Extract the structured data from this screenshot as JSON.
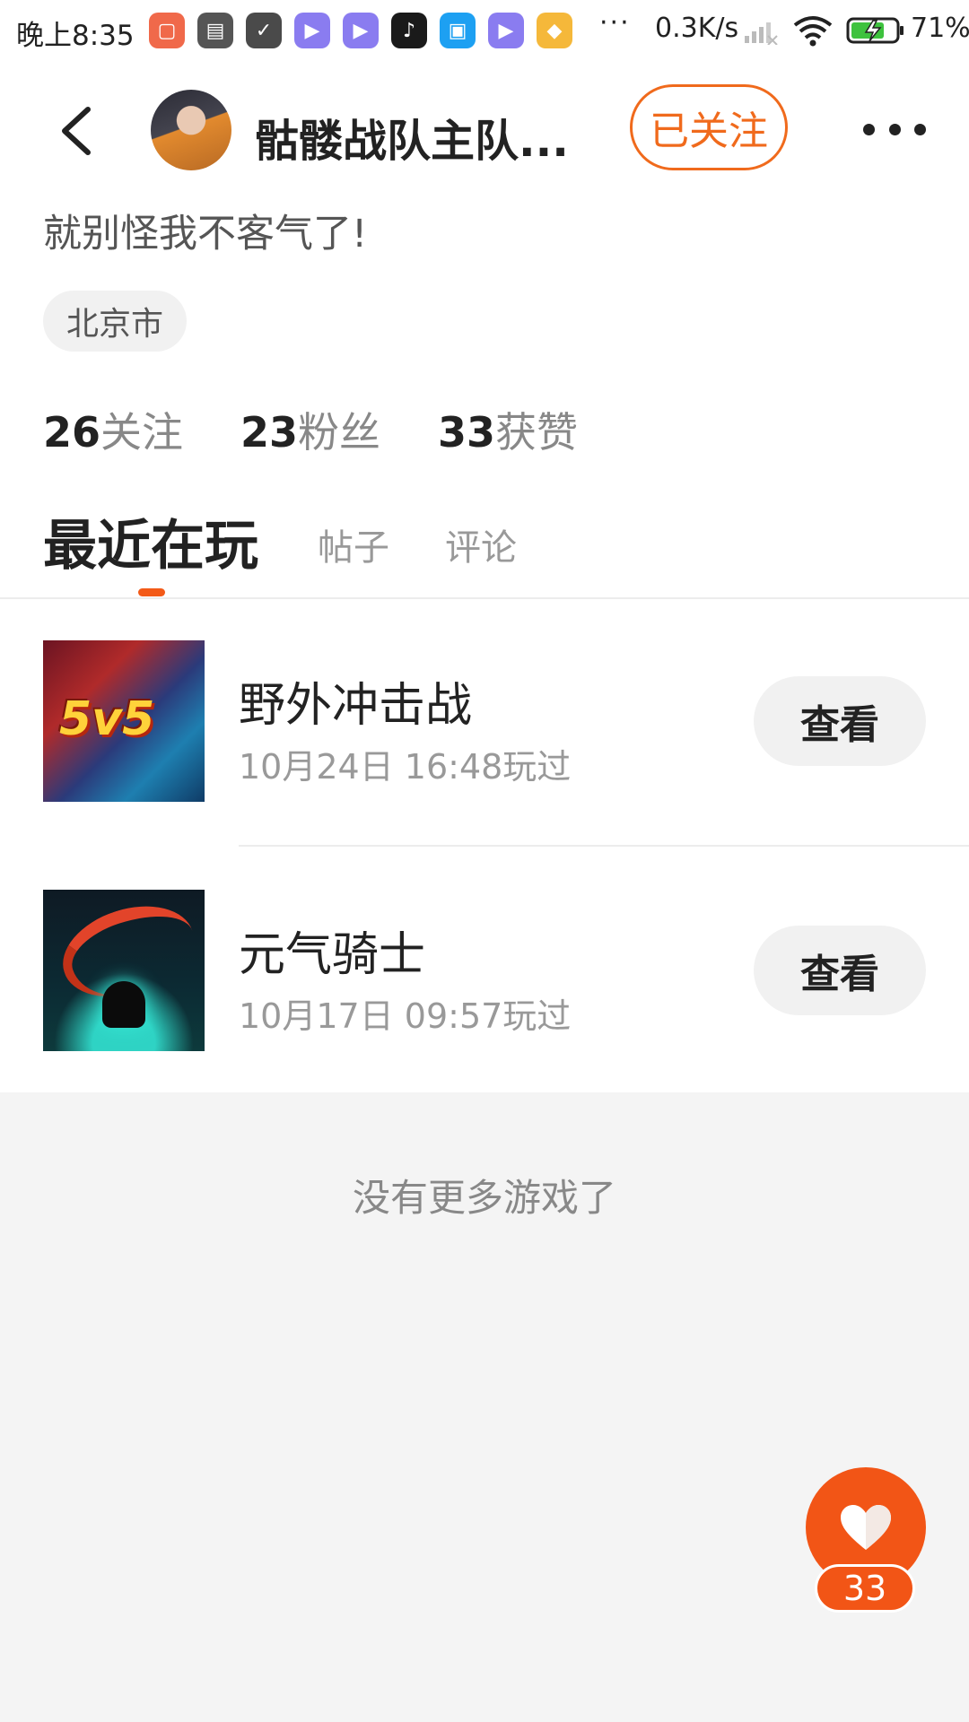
{
  "status_bar": {
    "time": "晚上8:35",
    "more": "···",
    "net_speed": "0.3K/s",
    "battery": "71%",
    "app_icons": [
      {
        "name": "app-store-icon",
        "color": "#f0694a",
        "glyph": "▢"
      },
      {
        "name": "mi-icon",
        "color": "#555555",
        "glyph": "▤"
      },
      {
        "name": "check-app-icon",
        "color": "#4a4a4a",
        "glyph": "✓"
      },
      {
        "name": "video-player-icon",
        "color": "#8a7cf0",
        "glyph": "▶"
      },
      {
        "name": "video-player-2-icon",
        "color": "#8a7cf0",
        "glyph": "▶"
      },
      {
        "name": "douyin-icon",
        "color": "#1a1a1a",
        "glyph": "♪"
      },
      {
        "name": "chat-app-icon",
        "color": "#1da0f2",
        "glyph": "▣"
      },
      {
        "name": "video-player-3-icon",
        "color": "#8a7cf0",
        "glyph": "▶"
      },
      {
        "name": "game-center-icon",
        "color": "#f5b83a",
        "glyph": "◆"
      }
    ]
  },
  "header": {
    "nickname": "骷髅战队主队...",
    "follow_label": "已关注"
  },
  "profile": {
    "bio": "就别怪我不客气了!",
    "location": "北京市",
    "stats": {
      "following_num": "26",
      "following_label": "关注",
      "fans_num": "23",
      "fans_label": "粉丝",
      "likes_num": "33",
      "likes_label": "获赞"
    }
  },
  "tabs": {
    "recent": "最近在玩",
    "posts": "帖子",
    "comments": "评论"
  },
  "games": [
    {
      "name": "野外冲击战",
      "played": "10月24日 16:48玩过",
      "view_label": "查看",
      "cover_text": "5v5"
    },
    {
      "name": "元气骑士",
      "played": "10月17日 09:57玩过",
      "view_label": "查看"
    }
  ],
  "footer": {
    "no_more": "没有更多游戏了",
    "like_count": "33"
  },
  "colors": {
    "accent": "#f25516",
    "follow_border": "#f06a1c"
  }
}
